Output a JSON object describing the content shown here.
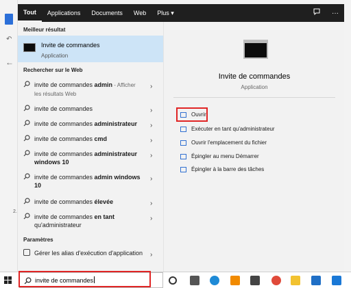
{
  "tabs": [
    "Tout",
    "Applications",
    "Documents",
    "Web",
    "Plus"
  ],
  "plus_caret": "▾",
  "topbar_icons": [
    "feedback-icon",
    "more-icon"
  ],
  "more_label": "···",
  "left": {
    "best_header": "Meilleur résultat",
    "best": {
      "title": "Invite de commandes",
      "subtitle": "Application"
    },
    "web_header": "Rechercher sur le Web",
    "web_items": [
      {
        "text": "invite de commandes ",
        "bold": "admin",
        "suffix": " - Afficher les résultats Web"
      },
      {
        "text": "invite de commandes",
        "bold": "",
        "suffix": ""
      },
      {
        "text": "invite de commandes ",
        "bold": "administrateur",
        "suffix": ""
      },
      {
        "text": "invite de commandes ",
        "bold": "cmd",
        "suffix": ""
      },
      {
        "text": "invite de commandes ",
        "bold": "administrateur windows 10",
        "suffix": ""
      },
      {
        "text": "invite de commandes ",
        "bold": "admin windows 10",
        "suffix": ""
      },
      {
        "text": "invite de commandes ",
        "bold": "élevée",
        "suffix": ""
      },
      {
        "text": "invite de commandes ",
        "bold": "en tant",
        "suffix": " qu'administrateur"
      }
    ],
    "settings_header": "Paramètres",
    "settings_item": "Gérer les alias d'exécution d'application"
  },
  "detail": {
    "title": "Invite de commandes",
    "subtitle": "Application",
    "actions": [
      "Ouvrir",
      "Exécuter en tant qu'administrateur",
      "Ouvrir l'emplacement du fichier",
      "Épingler au menu Démarrer",
      "Épingler à la barre des tâches"
    ]
  },
  "search": {
    "value": "invite de commandes"
  },
  "colors": {
    "accent": "#2f6fd1",
    "highlight": "#e02424",
    "selected": "#cde4f7",
    "topbar": "#1f1f1f"
  }
}
